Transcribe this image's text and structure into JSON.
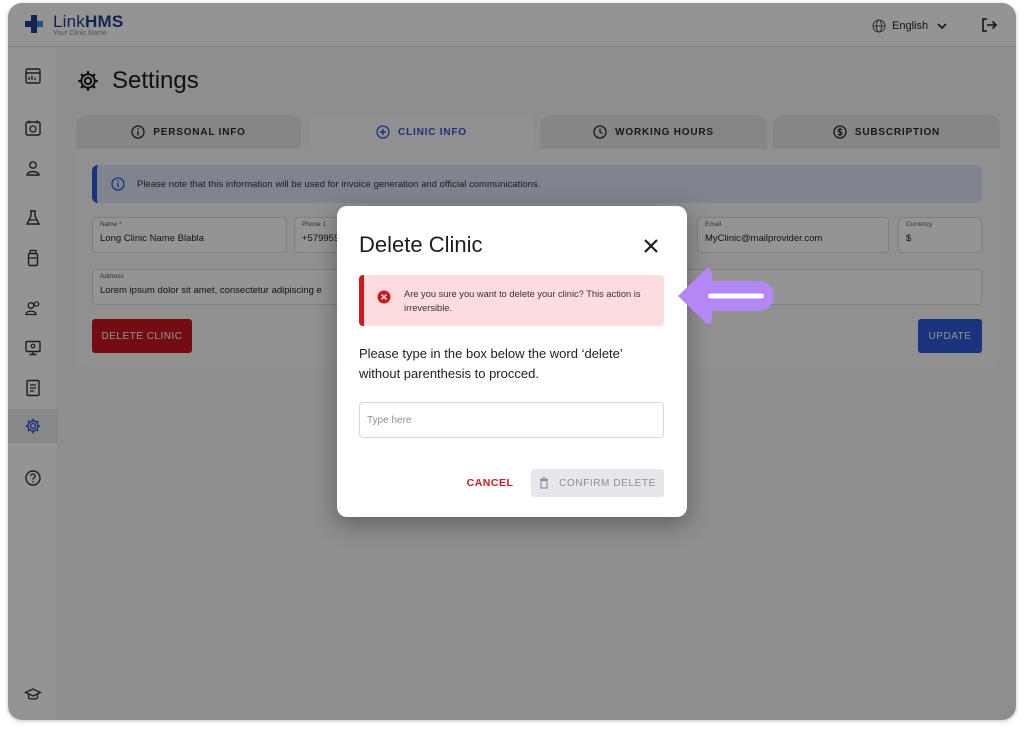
{
  "app": {
    "brand_light": "Link",
    "brand_bold": "HMS",
    "clinic_name": "Your Clinic Name"
  },
  "header": {
    "language": "English"
  },
  "sidebar": {
    "icons": [
      "dashboard-icon",
      "calendar-icon",
      "user-icon",
      "lab-flask-icon",
      "medicine-bottle-icon",
      "team-icon",
      "monitor-icon",
      "report-icon",
      "settings-icon",
      "help-icon",
      "graduation-cap-icon"
    ],
    "active": "settings-icon"
  },
  "page": {
    "title": "Settings"
  },
  "tabs": [
    {
      "label": "PERSONAL INFO",
      "icon": "info-icon"
    },
    {
      "label": "CLINIC INFO",
      "icon": "plus-circle-icon",
      "active": true
    },
    {
      "label": "WORKING HOURS",
      "icon": "clock-icon"
    },
    {
      "label": "SUBSCRIPTION",
      "icon": "dollar-icon"
    }
  ],
  "clinic_form": {
    "notice": "Please note that this information will be used for invoice generation and official communications.",
    "name": {
      "label": "Name *",
      "value": "Long Clinic Name Blabla"
    },
    "phone": {
      "label": "Phone 1",
      "value": "+579959"
    },
    "email": {
      "label": "Email",
      "value": "MyClinic@mailprovider.com"
    },
    "currency": {
      "label": "Currency",
      "value": "$"
    },
    "address": {
      "label": "Address",
      "value": "Lorem ipsum dolor sit amet, consectetur adipiscing e"
    },
    "delete_button": "DELETE CLINIC",
    "update_button": "UPDATE"
  },
  "modal": {
    "title": "Delete Clinic",
    "alert": "Are you sure you want to delete your clinic? This action is irreversible.",
    "instruction": "Please type in the box below the word ‘delete’ without parenthesis to procced.",
    "input_placeholder": "Type here",
    "input_value": "",
    "cancel_label": "CANCEL",
    "confirm_label": "CONFIRM DELETE"
  },
  "colors": {
    "brand_blue": "#2f57d8",
    "danger_red": "#d0191f",
    "alert_bg": "#fcdcdf",
    "pointer_purple": "#b388f6"
  }
}
